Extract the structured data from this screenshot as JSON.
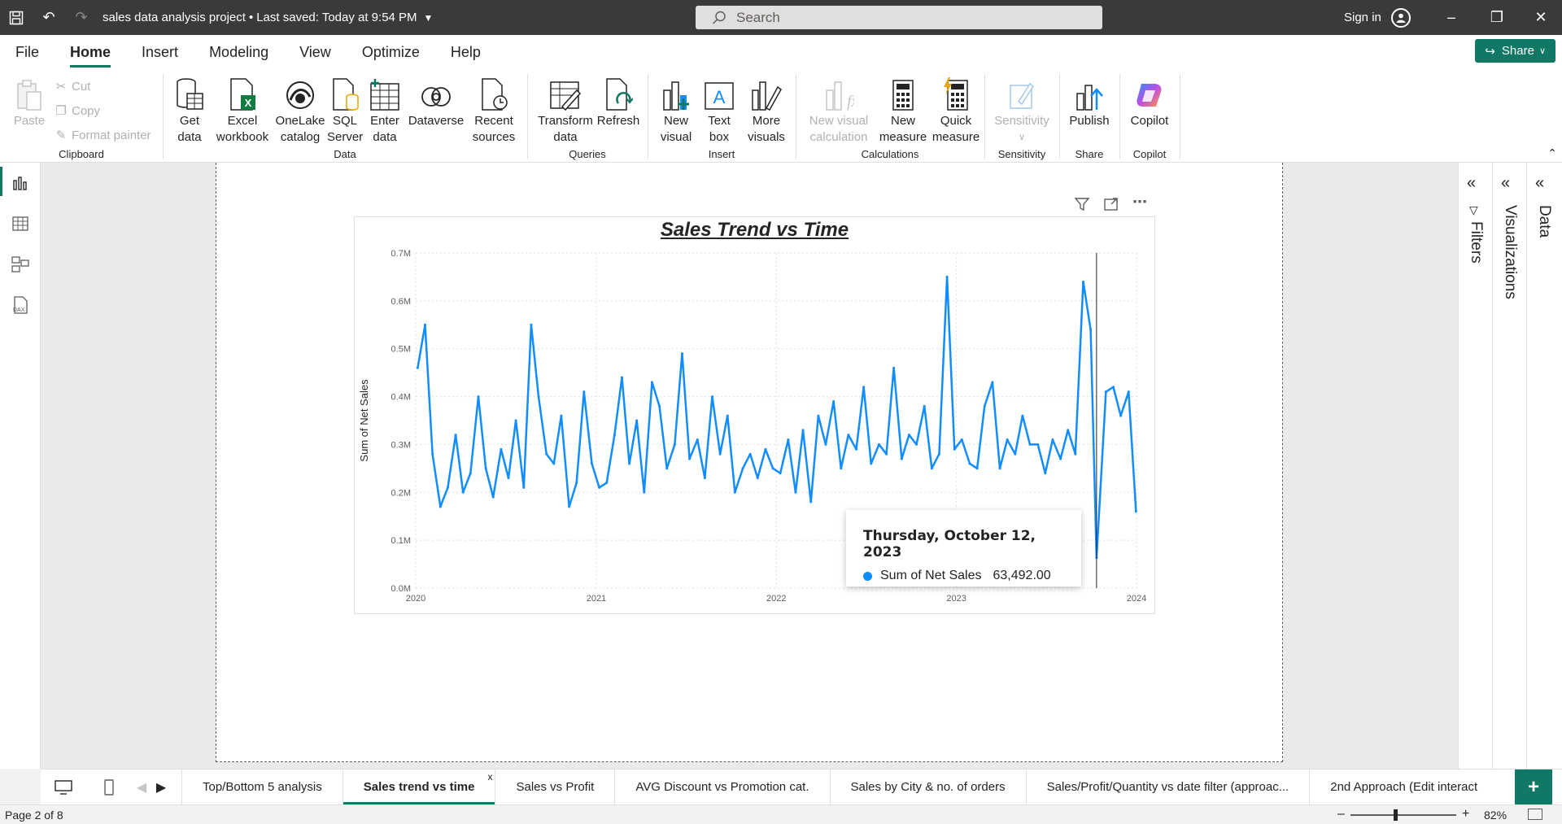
{
  "titlebar": {
    "title": "sales data analysis project",
    "saved": "Last saved: Today at 9:54 PM",
    "search_placeholder": "Search",
    "signin": "Sign in"
  },
  "menu": {
    "items": [
      "File",
      "Home",
      "Insert",
      "Modeling",
      "View",
      "Optimize",
      "Help"
    ],
    "active": "Home",
    "share": "Share"
  },
  "ribbon": {
    "clipboard": {
      "paste": "Paste",
      "cut": "Cut",
      "copy": "Copy",
      "format_painter": "Format painter",
      "label": "Clipboard"
    },
    "data": {
      "get_data": "Get data",
      "excel": "Excel workbook",
      "onelake": "OneLake catalog",
      "sql": "SQL Server",
      "enter_data": "Enter data",
      "dataverse": "Dataverse",
      "recent": "Recent sources",
      "label": "Data"
    },
    "queries": {
      "transform": "Transform data",
      "refresh": "Refresh",
      "label": "Queries"
    },
    "insert": {
      "new_visual": "New visual",
      "text_box": "Text box",
      "more_visuals": "More visuals",
      "label": "Insert"
    },
    "calculations": {
      "new_visual_calc": "New visual calculation",
      "new_measure": "New measure",
      "quick_measure": "Quick measure",
      "label": "Calculations"
    },
    "sensitivity": {
      "btn": "Sensitivity",
      "label": "Sensitivity"
    },
    "share": {
      "publish": "Publish",
      "label": "Share"
    },
    "copilot": {
      "btn": "Copilot",
      "label": "Copilot"
    }
  },
  "panes": {
    "filters": "Filters",
    "visualizations": "Visualizations",
    "data": "Data"
  },
  "tooltip": {
    "date": "Thursday, October 12, 2023",
    "measure": "Sum of Net Sales",
    "value": "63,492.00"
  },
  "tabs": [
    "Top/Bottom 5 analysis",
    "Sales trend vs time",
    "Sales vs Profit",
    "AVG Discount vs Promotion cat.",
    "Sales by City & no. of orders",
    "Sales/Profit/Quantity vs date filter (approac...",
    "2nd Approach (Edit interact"
  ],
  "active_tab": "Sales trend vs time",
  "status": {
    "page": "Page 2 of 8",
    "zoom": "82%"
  },
  "chart_data": {
    "type": "line",
    "title": "Sales Trend vs Time",
    "xlabel": "",
    "ylabel": "Sum of Net Sales",
    "x_ticks": [
      "2020",
      "2021",
      "2022",
      "2023",
      "2024"
    ],
    "y_ticks": [
      "0.0M",
      "0.1M",
      "0.2M",
      "0.3M",
      "0.4M",
      "0.5M",
      "0.6M",
      "0.7M"
    ],
    "ylim": [
      0,
      700000
    ],
    "xlim": [
      "2020-01-01",
      "2024-01-01"
    ],
    "grid": true,
    "color": "#118DFF",
    "hover_date": "2023-10-12",
    "series": [
      {
        "x": [
          "2020-01-05",
          "2020-01-20",
          "2020-02-04",
          "2020-02-20",
          "2020-03-06",
          "2020-03-22",
          "2020-04-06",
          "2020-04-21",
          "2020-05-07",
          "2020-05-22",
          "2020-06-06",
          "2020-06-22",
          "2020-07-07",
          "2020-07-22",
          "2020-08-07",
          "2020-08-22",
          "2020-09-06",
          "2020-09-22",
          "2020-10-07",
          "2020-10-22",
          "2020-11-07",
          "2020-11-22",
          "2020-12-07",
          "2020-12-23",
          "2021-01-07",
          "2021-01-22",
          "2021-02-07",
          "2021-02-22",
          "2021-03-09",
          "2021-03-24",
          "2021-04-08",
          "2021-04-24",
          "2021-05-09",
          "2021-05-24",
          "2021-06-09",
          "2021-06-24",
          "2021-07-09",
          "2021-07-25",
          "2021-08-09",
          "2021-08-24",
          "2021-09-09",
          "2021-09-24",
          "2021-10-09",
          "2021-10-25",
          "2021-11-09",
          "2021-11-24",
          "2021-12-10",
          "2021-12-25",
          "2022-01-09",
          "2022-01-25",
          "2022-02-09",
          "2022-02-24",
          "2022-03-12",
          "2022-03-27",
          "2022-04-11",
          "2022-04-27",
          "2022-05-12",
          "2022-05-27",
          "2022-06-12",
          "2022-06-27",
          "2022-07-12",
          "2022-07-28",
          "2022-08-12",
          "2022-08-27",
          "2022-09-12",
          "2022-09-27",
          "2022-10-12",
          "2022-10-28",
          "2022-11-12",
          "2022-11-27",
          "2022-12-13",
          "2022-12-28",
          "2023-01-12",
          "2023-01-28",
          "2023-02-12",
          "2023-02-27",
          "2023-03-15",
          "2023-03-30",
          "2023-04-14",
          "2023-04-30",
          "2023-05-15",
          "2023-05-30",
          "2023-06-15",
          "2023-06-30",
          "2023-07-15",
          "2023-07-31",
          "2023-08-15",
          "2023-08-30",
          "2023-09-15",
          "2023-09-30",
          "2023-10-12",
          "2023-10-31",
          "2023-11-15",
          "2023-11-30",
          "2023-12-16",
          "2023-12-31"
        ],
        "y": [
          460000,
          550000,
          280000,
          170000,
          210000,
          320000,
          200000,
          240000,
          400000,
          250000,
          190000,
          290000,
          230000,
          350000,
          210000,
          550000,
          400000,
          280000,
          260000,
          360000,
          170000,
          220000,
          410000,
          260000,
          210000,
          220000,
          320000,
          440000,
          260000,
          350000,
          200000,
          430000,
          380000,
          250000,
          300000,
          490000,
          270000,
          310000,
          230000,
          400000,
          280000,
          360000,
          200000,
          250000,
          280000,
          230000,
          290000,
          250000,
          240000,
          310000,
          200000,
          330000,
          180000,
          360000,
          300000,
          390000,
          250000,
          320000,
          290000,
          420000,
          260000,
          300000,
          280000,
          460000,
          270000,
          320000,
          300000,
          380000,
          250000,
          280000,
          650000,
          290000,
          310000,
          260000,
          250000,
          380000,
          430000,
          250000,
          310000,
          280000,
          360000,
          300000,
          300000,
          240000,
          310000,
          270000,
          330000,
          280000,
          640000,
          540000,
          63492,
          410000,
          420000,
          360000,
          410000,
          160000
        ]
      }
    ]
  }
}
